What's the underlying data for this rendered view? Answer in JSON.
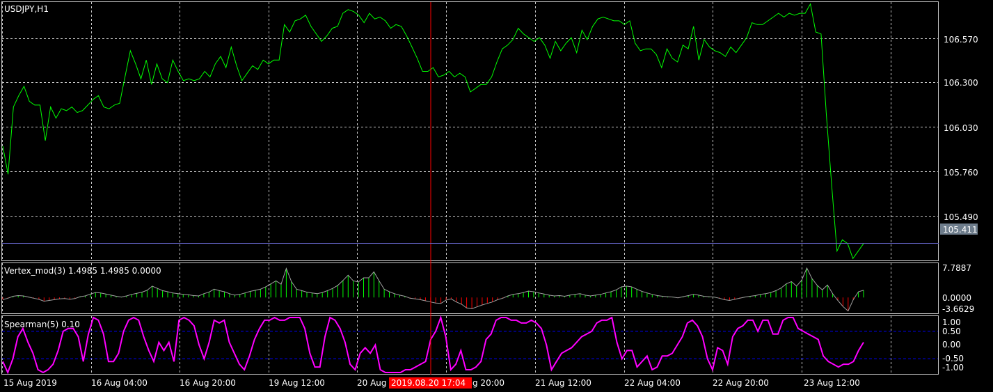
{
  "window": {
    "title": "USDJPY,H1"
  },
  "price_pane": {
    "symbol_label": "USDJPY,H1",
    "y_ticks": [
      "106.570",
      "106.300",
      "106.030",
      "105.760",
      "105.490"
    ],
    "current_price": "105.411",
    "line_color": "#00ff00",
    "current_line_color": "#6464c8"
  },
  "vertex_pane": {
    "label": "Vertex_mod(3) 1.4985 1.4985 0.0000",
    "y_ticks": [
      "7.7887",
      "0.0000",
      "-3.6629"
    ],
    "pos_color": "#00ff00",
    "neg_color": "#ff0000"
  },
  "spearman_pane": {
    "label": "Spearman(5) 0.10",
    "y_ticks": [
      "1.00",
      "0.50",
      "0.00",
      "-0.50",
      "-1.00"
    ],
    "line_color": "#ff00ff",
    "level_color": "#0000ff"
  },
  "time_axis": {
    "labels": [
      "15 Aug 2019",
      "16 Aug 04:00",
      "16 Aug 20:00",
      "19 Aug 12:00",
      "20 Aug",
      "g 20:00",
      "21 Aug 12:00",
      "22 Aug 04:00",
      "22 Aug 20:00",
      "23 Aug 12:00"
    ],
    "crosshair_label": "2019.08.20 17:04",
    "crosshair_color": "#ff0000"
  },
  "chart_data": [
    {
      "type": "line",
      "title": "USDJPY,H1",
      "ylim": [
        105.32,
        106.7
      ],
      "values": [
        105.93,
        105.78,
        106.14,
        106.2,
        106.25,
        106.17,
        106.15,
        106.15,
        105.96,
        106.14,
        106.08,
        106.13,
        106.12,
        106.14,
        106.11,
        106.12,
        106.15,
        106.18,
        106.2,
        106.14,
        106.13,
        106.15,
        106.16,
        106.3,
        106.44,
        106.37,
        106.29,
        106.39,
        106.26,
        106.37,
        106.29,
        106.27,
        106.39,
        106.33,
        106.28,
        106.29,
        106.28,
        106.29,
        106.33,
        106.3,
        106.37,
        106.41,
        106.35,
        106.46,
        106.36,
        106.28,
        106.32,
        106.36,
        106.34,
        106.39,
        106.37,
        106.39,
        106.39,
        106.58,
        106.54,
        106.6,
        106.61,
        106.63,
        106.57,
        106.53,
        106.49,
        106.52,
        106.56,
        106.57,
        106.64,
        106.66,
        106.65,
        106.63,
        106.59,
        106.64,
        106.61,
        106.62,
        106.6,
        106.56,
        106.58,
        106.57,
        106.52,
        106.46,
        106.4,
        106.33,
        106.33,
        106.35,
        106.3,
        106.31,
        106.33,
        106.3,
        106.32,
        106.3,
        106.22,
        106.24,
        106.26,
        106.26,
        106.3,
        106.38,
        106.45,
        106.47,
        106.5,
        106.56,
        106.53,
        106.51,
        106.49,
        106.51,
        106.47,
        106.4,
        106.49,
        106.44,
        106.48,
        106.51,
        106.43,
        106.55,
        106.5,
        106.57,
        106.61,
        106.62,
        106.61,
        106.6,
        106.6,
        106.58,
        106.6,
        106.48,
        106.44,
        106.45,
        106.45,
        106.42,
        106.35,
        106.45,
        106.4,
        106.38,
        106.47,
        106.45,
        106.57,
        106.39,
        106.5,
        106.46,
        106.44,
        106.43,
        106.41,
        106.46,
        106.43,
        106.47,
        106.51,
        106.59,
        106.58,
        106.58,
        106.6,
        106.62,
        106.64,
        106.62,
        106.64,
        106.63,
        106.64,
        106.64,
        106.69,
        106.54,
        106.53,
        106.1,
        105.72,
        105.37,
        105.43,
        105.41,
        105.33,
        105.37,
        105.41
      ]
    },
    {
      "type": "bar",
      "title": "Vertex_mod(3) 1.4985 1.4985 0.0000",
      "ylim": [
        -3.6629,
        7.7887
      ],
      "values": [
        -0.6,
        -0.2,
        0.3,
        0.5,
        0.4,
        0.1,
        -0.2,
        -0.5,
        -1.0,
        -0.8,
        -0.6,
        -0.4,
        -0.3,
        -0.5,
        -0.3,
        0.2,
        0.4,
        0.9,
        1.3,
        1.2,
        0.9,
        0.6,
        0.3,
        0.1,
        0.4,
        0.8,
        1.1,
        1.4,
        1.9,
        3.0,
        2.4,
        1.8,
        1.5,
        1.2,
        1.0,
        0.8,
        0.7,
        0.5,
        0.4,
        1.0,
        1.4,
        2.2,
        1.8,
        1.5,
        1.0,
        0.6,
        0.8,
        1.2,
        1.6,
        1.9,
        2.2,
        2.8,
        3.6,
        4.4,
        3.5,
        7.7,
        4.2,
        2.2,
        1.8,
        1.4,
        1.2,
        1.0,
        1.3,
        1.8,
        2.4,
        3.2,
        4.5,
        5.9,
        4.4,
        4.1,
        5.2,
        5.2,
        6.8,
        4.4,
        2.2,
        1.5,
        1.0,
        0.6,
        0.3,
        -0.2,
        -0.4,
        -0.6,
        -0.9,
        -1.2,
        -1.5,
        -1.6,
        -0.7,
        -0.4,
        -1.2,
        -1.8,
        -2.8,
        -3.0,
        -2.5,
        -2.0,
        -1.6,
        -1.2,
        -0.6,
        -0.2,
        0.4,
        0.8,
        1.0,
        1.3,
        1.7,
        1.5,
        1.2,
        0.9,
        0.6,
        0.4,
        0.5,
        0.3,
        0.6,
        0.8,
        1.0,
        0.6,
        0.4,
        0.6,
        0.8,
        1.2,
        1.5,
        2.0,
        2.8,
        3.0,
        2.8,
        2.2,
        1.6,
        1.2,
        0.8,
        0.5,
        0.3,
        0.2,
        0.1,
        -0.1,
        0.2,
        0.5,
        0.8,
        0.6,
        0.3,
        0.2,
        0.1,
        -0.2,
        -0.6,
        -0.8,
        -0.5,
        -0.2,
        0.1,
        0.3,
        0.5,
        0.8,
        1.0,
        1.3,
        1.8,
        2.5,
        3.6,
        4.2,
        3.0,
        4.6,
        7.8,
        5.0,
        3.2,
        2.0,
        3.3,
        1.0,
        -0.8,
        -2.4,
        -3.6,
        -0.6,
        1.5,
        1.9
      ]
    },
    {
      "type": "line",
      "title": "Spearman(5) 0.10",
      "ylim": [
        -1.0,
        1.0
      ],
      "levels": [
        0.5,
        -0.5
      ],
      "values": [
        -0.6,
        -1.0,
        -0.5,
        0.3,
        0.6,
        0.1,
        -0.3,
        -0.9,
        -1.0,
        -0.9,
        -0.7,
        -0.2,
        0.5,
        0.6,
        0.6,
        0.3,
        -0.6,
        0.4,
        1.0,
        0.9,
        0.4,
        -0.6,
        -0.6,
        -0.3,
        0.5,
        0.9,
        1.0,
        0.9,
        0.3,
        -0.2,
        -0.6,
        0.1,
        -0.2,
        0.1,
        -0.6,
        0.9,
        1.0,
        0.9,
        0.7,
        0.0,
        -0.5,
        0.1,
        0.9,
        0.8,
        0.9,
        0.1,
        -0.3,
        -0.7,
        -0.9,
        -0.4,
        0.2,
        0.6,
        0.9,
        0.9,
        1.0,
        0.9,
        0.9,
        1.0,
        1.0,
        1.0,
        0.6,
        -0.3,
        -0.8,
        -0.8,
        0.3,
        1.0,
        0.9,
        0.6,
        0.1,
        -0.7,
        -0.9,
        -0.3,
        -0.1,
        -0.3,
        0.0,
        -0.9,
        -1.0,
        -1.0,
        -1.0,
        -1.0,
        -0.9,
        -0.9,
        -0.8,
        -0.7,
        -0.6,
        0.2,
        0.5,
        1.0,
        0.3,
        -0.9,
        -0.7,
        -0.2,
        -0.9,
        -0.9,
        -0.8,
        -0.6,
        0.2,
        0.4,
        0.9,
        1.0,
        1.0,
        0.9,
        0.9,
        0.8,
        0.8,
        0.9,
        0.8,
        0.6,
        0.0,
        -0.9,
        -0.6,
        -0.3,
        -0.2,
        -0.1,
        0.1,
        0.3,
        0.4,
        0.5,
        0.8,
        0.9,
        0.9,
        1.0,
        0.1,
        -0.5,
        -0.2,
        -0.2,
        -0.8,
        -0.6,
        -0.4,
        -0.9,
        -0.8,
        -0.4,
        -0.4,
        -0.3,
        0.0,
        0.3,
        0.8,
        0.9,
        0.7,
        0.3,
        -0.5,
        -0.9,
        -0.1,
        -0.2,
        -0.7,
        0.3,
        0.6,
        0.7,
        0.9,
        0.9,
        0.5,
        0.9,
        0.9,
        0.4,
        0.4,
        0.9,
        1.0,
        1.0,
        0.6,
        0.5,
        0.4,
        0.3,
        0.2,
        -0.4,
        -0.6,
        -0.7,
        -0.8,
        -0.7,
        -0.7,
        -0.6,
        -0.2,
        0.1
      ]
    }
  ]
}
